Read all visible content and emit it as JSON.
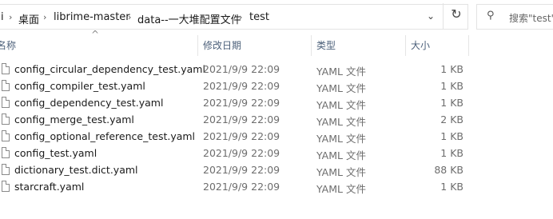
{
  "address": {
    "breadcrumb_lead": "i",
    "crumbs": [
      "桌面",
      "librime-master",
      "data--一大堆配置文件",
      "test"
    ],
    "separator_icon": "chevron-right-icon",
    "dropdown_icon": "chevron-down-icon",
    "refresh_icon": "refresh-icon"
  },
  "search": {
    "placeholder": "搜索\"test\"",
    "icon": "search-icon"
  },
  "columns": {
    "name": "名称",
    "date": "修改日期",
    "type": "类型",
    "size": "大小"
  },
  "files": [
    {
      "name": "config_circular_dependency_test.yaml",
      "date": "2021/9/9 22:09",
      "type": "YAML 文件",
      "size": "1 KB"
    },
    {
      "name": "config_compiler_test.yaml",
      "date": "2021/9/9 22:09",
      "type": "YAML 文件",
      "size": "1 KB"
    },
    {
      "name": "config_dependency_test.yaml",
      "date": "2021/9/9 22:09",
      "type": "YAML 文件",
      "size": "1 KB"
    },
    {
      "name": "config_merge_test.yaml",
      "date": "2021/9/9 22:09",
      "type": "YAML 文件",
      "size": "2 KB"
    },
    {
      "name": "config_optional_reference_test.yaml",
      "date": "2021/9/9 22:09",
      "type": "YAML 文件",
      "size": "1 KB"
    },
    {
      "name": "config_test.yaml",
      "date": "2021/9/9 22:09",
      "type": "YAML 文件",
      "size": "1 KB"
    },
    {
      "name": "dictionary_test.dict.yaml",
      "date": "2021/9/9 22:09",
      "type": "YAML 文件",
      "size": "88 KB"
    },
    {
      "name": "starcraft.yaml",
      "date": "2021/9/9 22:09",
      "type": "YAML 文件",
      "size": "1 KB"
    }
  ]
}
